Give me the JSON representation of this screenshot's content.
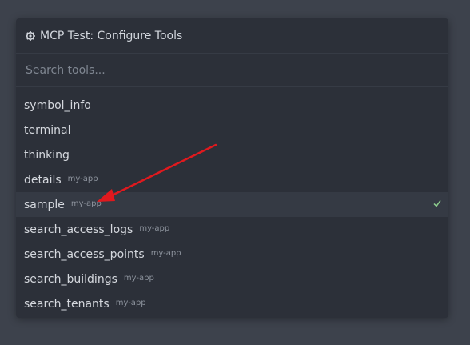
{
  "header": {
    "title": "MCP Test: Configure Tools",
    "icon": "gear-icon"
  },
  "search": {
    "placeholder": "Search tools...",
    "value": ""
  },
  "tools": [
    {
      "name": "symbol_info",
      "tag": ""
    },
    {
      "name": "terminal",
      "tag": ""
    },
    {
      "name": "thinking",
      "tag": ""
    },
    {
      "name": "details",
      "tag": "my-app"
    },
    {
      "name": "sample",
      "tag": "my-app",
      "selected": true
    },
    {
      "name": "search_access_logs",
      "tag": "my-app"
    },
    {
      "name": "search_access_points",
      "tag": "my-app"
    },
    {
      "name": "search_buildings",
      "tag": "my-app"
    },
    {
      "name": "search_tenants",
      "tag": "my-app"
    }
  ],
  "annotation": {
    "arrow_color": "#e0191e",
    "icon": "red-arrow-annotation"
  },
  "colors": {
    "background": "#3d424c",
    "panel": "#2c3039",
    "selected_row": "#353a44",
    "check": "#8fd08f"
  }
}
